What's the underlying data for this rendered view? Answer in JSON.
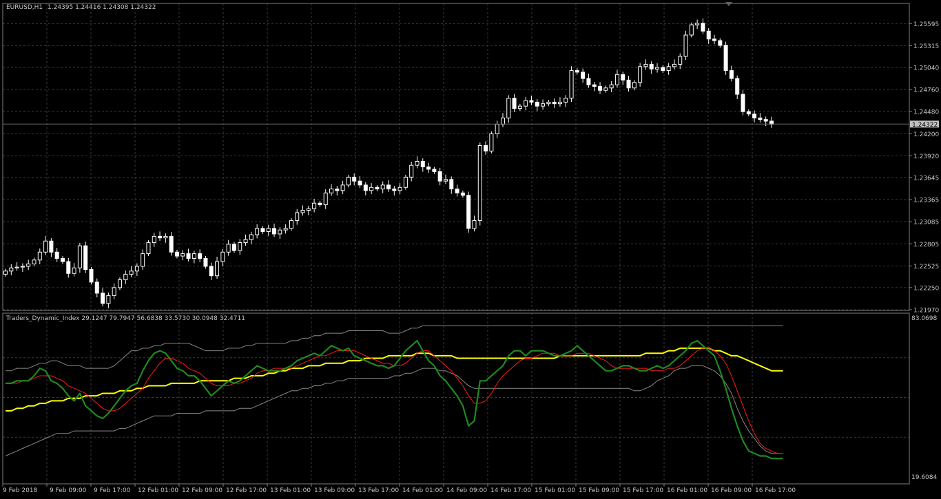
{
  "price_panel": {
    "symbol_label": "EURUSD,H1",
    "ohlc_label": "1.24395 1.24416 1.24308 1.24322",
    "current_price_label": "1.24322"
  },
  "indicator_panel": {
    "label": "Traders_Dynamic_Index 29.1247 79.7947 56.6838 33.5730 30.0948 32.4711"
  },
  "colors": {
    "background": "#000000",
    "grid": "#3a3a3a",
    "frame": "#808080",
    "candle": "#ffffff",
    "rsi_line": "#1f8a1f",
    "signal_line": "#ff1a1a",
    "market_base_line": "#ffff00",
    "band_lines": "#8a8a8a"
  },
  "chart_data": [
    {
      "type": "candlestick",
      "title": "EURUSD,H1",
      "ylim": [
        1.2197,
        1.2572
      ],
      "y_ticks": [
        "1.25595",
        "1.25315",
        "1.25040",
        "1.24760",
        "1.24480",
        "1.24200",
        "1.23920",
        "1.23645",
        "1.23365",
        "1.23085",
        "1.22805",
        "1.22525",
        "1.22250",
        "1.21970"
      ],
      "x_ticks": [
        "9 Feb 2018",
        "9 Feb 09:00",
        "9 Feb 17:00",
        "12 Feb 01:00",
        "12 Feb 09:00",
        "12 Feb 17:00",
        "13 Feb 01:00",
        "13 Feb 09:00",
        "13 Feb 17:00",
        "14 Feb 01:00",
        "14 Feb 09:00",
        "14 Feb 17:00",
        "15 Feb 01:00",
        "15 Feb 09:00",
        "15 Feb 17:00",
        "16 Feb 01:00",
        "16 Feb 09:00",
        "16 Feb 17:00"
      ],
      "grid": true,
      "last_price": 1.24322,
      "close": [
        1.2246,
        1.225,
        1.2251,
        1.2252,
        1.2255,
        1.226,
        1.227,
        1.2284,
        1.227,
        1.2262,
        1.2258,
        1.2243,
        1.225,
        1.2278,
        1.2248,
        1.2232,
        1.2218,
        1.2205,
        1.2215,
        1.2225,
        1.2235,
        1.2242,
        1.2246,
        1.2252,
        1.2268,
        1.2282,
        1.229,
        1.2288,
        1.229,
        1.227,
        1.2265,
        1.2268,
        1.2262,
        1.2268,
        1.2262,
        1.2252,
        1.224,
        1.2258,
        1.227,
        1.228,
        1.2272,
        1.2282,
        1.2286,
        1.2292,
        1.23,
        1.2296,
        1.23,
        1.2293,
        1.2298,
        1.23,
        1.231,
        1.232,
        1.2323,
        1.2325,
        1.2332,
        1.233,
        1.2345,
        1.235,
        1.2348,
        1.2355,
        1.2365,
        1.236,
        1.2355,
        1.2348,
        1.2352,
        1.235,
        1.2355,
        1.235,
        1.2348,
        1.2352,
        1.2365,
        1.238,
        1.2385,
        1.2378,
        1.2375,
        1.2372,
        1.236,
        1.2362,
        1.235,
        1.2345,
        1.2342,
        1.23,
        1.231,
        1.2405,
        1.2398,
        1.242,
        1.2432,
        1.244,
        1.2465,
        1.2452,
        1.2455,
        1.2462,
        1.246,
        1.2455,
        1.2458,
        1.246,
        1.2458,
        1.246,
        1.2465,
        1.25,
        1.2498,
        1.249,
        1.2482,
        1.248,
        1.2475,
        1.2478,
        1.2482,
        1.2495,
        1.2488,
        1.2478,
        1.2485,
        1.2505,
        1.2508,
        1.2502,
        1.2504,
        1.25,
        1.2505,
        1.2508,
        1.2518,
        1.2545,
        1.2558,
        1.256,
        1.255,
        1.254,
        1.2538,
        1.2532,
        1.25,
        1.249,
        1.247,
        1.2448,
        1.2445,
        1.244,
        1.2438,
        1.2436,
        1.2432
      ]
    },
    {
      "type": "line",
      "title": "Traders_Dynamic_Index",
      "ylim": [
        19.6084,
        83.0698
      ],
      "y_ticks": [
        "83.0698",
        "19.6084"
      ],
      "grid": true,
      "series": [
        {
          "values": [
            57,
            57,
            58,
            58,
            58,
            60,
            63,
            62,
            58,
            57,
            55,
            52,
            50,
            53,
            48,
            46,
            44,
            43,
            45,
            48,
            51,
            54,
            56,
            57,
            62,
            66,
            69,
            70,
            69,
            66,
            63,
            62,
            60,
            60,
            58,
            55,
            52,
            54,
            56,
            58,
            57,
            58,
            60,
            62,
            64,
            63,
            62,
            62,
            62,
            63,
            64,
            66,
            67,
            68,
            69,
            68,
            70,
            72,
            71,
            70,
            71,
            68,
            67,
            66,
            65,
            64,
            64,
            63,
            64,
            67,
            70,
            72,
            74,
            70,
            66,
            64,
            60,
            58,
            55,
            52,
            48,
            40,
            42,
            58,
            58,
            60,
            62,
            64,
            68,
            70,
            70,
            68,
            70,
            70,
            70,
            69,
            68,
            68,
            69,
            70,
            72,
            70,
            68,
            66,
            64,
            62,
            62,
            63,
            64,
            64,
            63,
            62,
            62,
            63,
            64,
            63,
            64,
            66,
            68,
            70,
            73,
            74,
            72,
            70,
            68,
            62,
            55,
            47,
            40,
            34,
            30,
            29,
            28,
            28,
            27,
            27,
            27
          ]
        },
        {
          "values": [
            57,
            57,
            57,
            58,
            58,
            59,
            60,
            60,
            60,
            59,
            58,
            56,
            55,
            54,
            53,
            51,
            49,
            47,
            46,
            46,
            47,
            49,
            51,
            53,
            55,
            59,
            62,
            65,
            67,
            67,
            66,
            65,
            63,
            62,
            61,
            59,
            57,
            56,
            56,
            56,
            57,
            57,
            58,
            59,
            61,
            62,
            62,
            63,
            63,
            63,
            63,
            64,
            65,
            66,
            67,
            68,
            68,
            69,
            70,
            70,
            70,
            70,
            69,
            68,
            67,
            66,
            65,
            65,
            64,
            64,
            65,
            67,
            69,
            70,
            70,
            68,
            66,
            64,
            62,
            59,
            56,
            52,
            49,
            49,
            50,
            53,
            57,
            60,
            62,
            64,
            66,
            67,
            67,
            68,
            69,
            69,
            69,
            68,
            68,
            68,
            69,
            69,
            69,
            68,
            67,
            66,
            64,
            63,
            63,
            63,
            63,
            63,
            63,
            62,
            62,
            62,
            63,
            63,
            64,
            66,
            68,
            70,
            71,
            71,
            70,
            68,
            65,
            60,
            54,
            48,
            42,
            37,
            33,
            31,
            30,
            29,
            29
          ]
        },
        {
          "values": [
            46,
            46,
            47,
            47,
            48,
            48,
            49,
            49,
            50,
            50,
            50,
            51,
            51,
            51,
            52,
            52,
            52,
            53,
            53,
            53,
            54,
            54,
            54,
            55,
            55,
            56,
            56,
            56,
            56,
            57,
            57,
            57,
            57,
            57,
            58,
            58,
            58,
            58,
            58,
            58,
            59,
            59,
            59,
            60,
            60,
            60,
            61,
            61,
            62,
            62,
            63,
            63,
            63,
            64,
            64,
            64,
            65,
            65,
            65,
            65,
            66,
            66,
            66,
            67,
            67,
            67,
            67,
            68,
            68,
            68,
            68,
            68,
            69,
            69,
            69,
            68,
            68,
            68,
            68,
            67,
            67,
            67,
            67,
            67,
            67,
            67,
            67,
            67,
            67,
            67,
            67,
            67,
            67,
            67,
            67,
            67,
            67,
            68,
            68,
            68,
            68,
            68,
            68,
            68,
            68,
            68,
            68,
            68,
            68,
            68,
            68,
            68,
            69,
            69,
            69,
            69,
            70,
            70,
            71,
            71,
            71,
            71,
            71,
            71,
            70,
            70,
            69,
            68,
            68,
            67,
            66,
            65,
            64,
            63,
            62,
            62,
            62
          ]
        },
        {
          "values": [
            62,
            62,
            63,
            63,
            63,
            64,
            65,
            65,
            66,
            66,
            65,
            64,
            64,
            64,
            63,
            63,
            63,
            63,
            63,
            64,
            66,
            68,
            70,
            70,
            71,
            71,
            72,
            72,
            73,
            73,
            73,
            73,
            73,
            72,
            71,
            70,
            70,
            70,
            70,
            71,
            71,
            71,
            72,
            72,
            73,
            73,
            73,
            73,
            73,
            73,
            74,
            74,
            75,
            75,
            76,
            76,
            77,
            77,
            77,
            77,
            78,
            78,
            78,
            78,
            78,
            78,
            78,
            77,
            77,
            77,
            78,
            79,
            79,
            80,
            80,
            80,
            80,
            80,
            80,
            80,
            80,
            80,
            80,
            80,
            80,
            80,
            80,
            80,
            80,
            80,
            80,
            80,
            80,
            80,
            80,
            80,
            80,
            80,
            80,
            80,
            80,
            80,
            80,
            80,
            80,
            80,
            80,
            80,
            80,
            80,
            80,
            80,
            80,
            80,
            80,
            80,
            80,
            80,
            80,
            80,
            80,
            80,
            80,
            80,
            80,
            80,
            80,
            80,
            80,
            80,
            80,
            80,
            80,
            80,
            80,
            80,
            80
          ]
        },
        {
          "values": [
            28,
            29,
            30,
            31,
            32,
            33,
            34,
            35,
            36,
            37,
            37,
            37,
            38,
            38,
            38,
            38,
            38,
            38,
            38,
            38,
            39,
            39,
            40,
            41,
            42,
            43,
            44,
            44,
            44,
            44,
            45,
            45,
            45,
            45,
            45,
            46,
            46,
            46,
            46,
            46,
            46,
            47,
            47,
            47,
            48,
            49,
            50,
            51,
            52,
            53,
            54,
            54,
            55,
            55,
            56,
            56,
            57,
            57,
            58,
            58,
            59,
            59,
            59,
            59,
            59,
            59,
            59,
            59,
            60,
            60,
            61,
            61,
            62,
            63,
            63,
            63,
            62,
            62,
            61,
            60,
            58,
            56,
            55,
            55,
            55,
            55,
            55,
            55,
            55,
            55,
            55,
            55,
            55,
            55,
            55,
            55,
            55,
            55,
            55,
            55,
            55,
            55,
            55,
            55,
            55,
            55,
            55,
            55,
            55,
            55,
            54,
            54,
            55,
            56,
            58,
            59,
            60,
            62,
            63,
            63,
            64,
            64,
            64,
            63,
            62,
            60,
            57,
            53,
            47,
            42,
            38,
            35,
            32,
            30,
            29,
            29,
            29
          ]
        }
      ]
    }
  ]
}
